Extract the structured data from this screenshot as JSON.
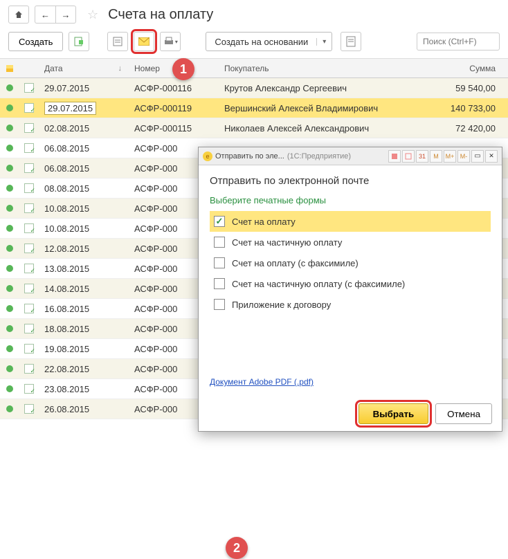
{
  "page_title": "Счета на оплату",
  "toolbar": {
    "create": "Создать",
    "create_based": "Создать на основании",
    "search_placeholder": "Поиск (Ctrl+F)"
  },
  "grid": {
    "headers": {
      "date": "Дата",
      "num": "Номер",
      "buyer": "Покупатель",
      "sum": "Сумма"
    },
    "rows": [
      {
        "date": "29.07.2015",
        "num": "АСФР-000116",
        "buyer": "Крутов Александр Сергеевич",
        "sum": "59 540,00",
        "alt": true
      },
      {
        "date": "29.07.2015",
        "num": "АСФР-000119",
        "buyer": "Вершинский Алексей Владимирович",
        "sum": "140 733,00",
        "sel": true
      },
      {
        "date": "02.08.2015",
        "num": "АСФР-000115",
        "buyer": "Николаев Алексей Александрович",
        "sum": "72 420,00"
      },
      {
        "date": "06.08.2015",
        "num": "АСФР-000",
        "buyer": "",
        "sum": ""
      },
      {
        "date": "06.08.2015",
        "num": "АСФР-000",
        "buyer": "",
        "sum": ""
      },
      {
        "date": "08.08.2015",
        "num": "АСФР-000",
        "buyer": "",
        "sum": ""
      },
      {
        "date": "10.08.2015",
        "num": "АСФР-000",
        "buyer": "",
        "sum": ""
      },
      {
        "date": "10.08.2015",
        "num": "АСФР-000",
        "buyer": "",
        "sum": ""
      },
      {
        "date": "12.08.2015",
        "num": "АСФР-000",
        "buyer": "",
        "sum": ""
      },
      {
        "date": "13.08.2015",
        "num": "АСФР-000",
        "buyer": "",
        "sum": ""
      },
      {
        "date": "14.08.2015",
        "num": "АСФР-000",
        "buyer": "",
        "sum": ""
      },
      {
        "date": "16.08.2015",
        "num": "АСФР-000",
        "buyer": "",
        "sum": ""
      },
      {
        "date": "18.08.2015",
        "num": "АСФР-000",
        "buyer": "",
        "sum": ""
      },
      {
        "date": "19.08.2015",
        "num": "АСФР-000",
        "buyer": "",
        "sum": ""
      },
      {
        "date": "22.08.2015",
        "num": "АСФР-000",
        "buyer": "",
        "sum": ""
      },
      {
        "date": "23.08.2015",
        "num": "АСФР-000",
        "buyer": "",
        "sum": ""
      },
      {
        "date": "26.08.2015",
        "num": "АСФР-000",
        "buyer": "",
        "sum": ""
      }
    ]
  },
  "modal": {
    "window_title": "Отправить по эле...",
    "window_sub": "(1С:Предприятие)",
    "heading": "Отправить по электронной почте",
    "subheading": "Выберите печатные формы",
    "forms": [
      {
        "label": "Счет на оплату",
        "checked": true
      },
      {
        "label": "Счет на частичную оплату",
        "checked": false
      },
      {
        "label": "Счет на оплату (с факсимиле)",
        "checked": false
      },
      {
        "label": "Счет на частичную оплату (с факсимиле)",
        "checked": false
      },
      {
        "label": "Приложение к договору",
        "checked": false
      }
    ],
    "pdf_link": "Документ Adobe PDF (.pdf)",
    "select_btn": "Выбрать",
    "cancel_btn": "Отмена",
    "mt_labels": [
      "M",
      "M+",
      "M-"
    ]
  },
  "badges": {
    "b1": "1",
    "b2": "2"
  }
}
